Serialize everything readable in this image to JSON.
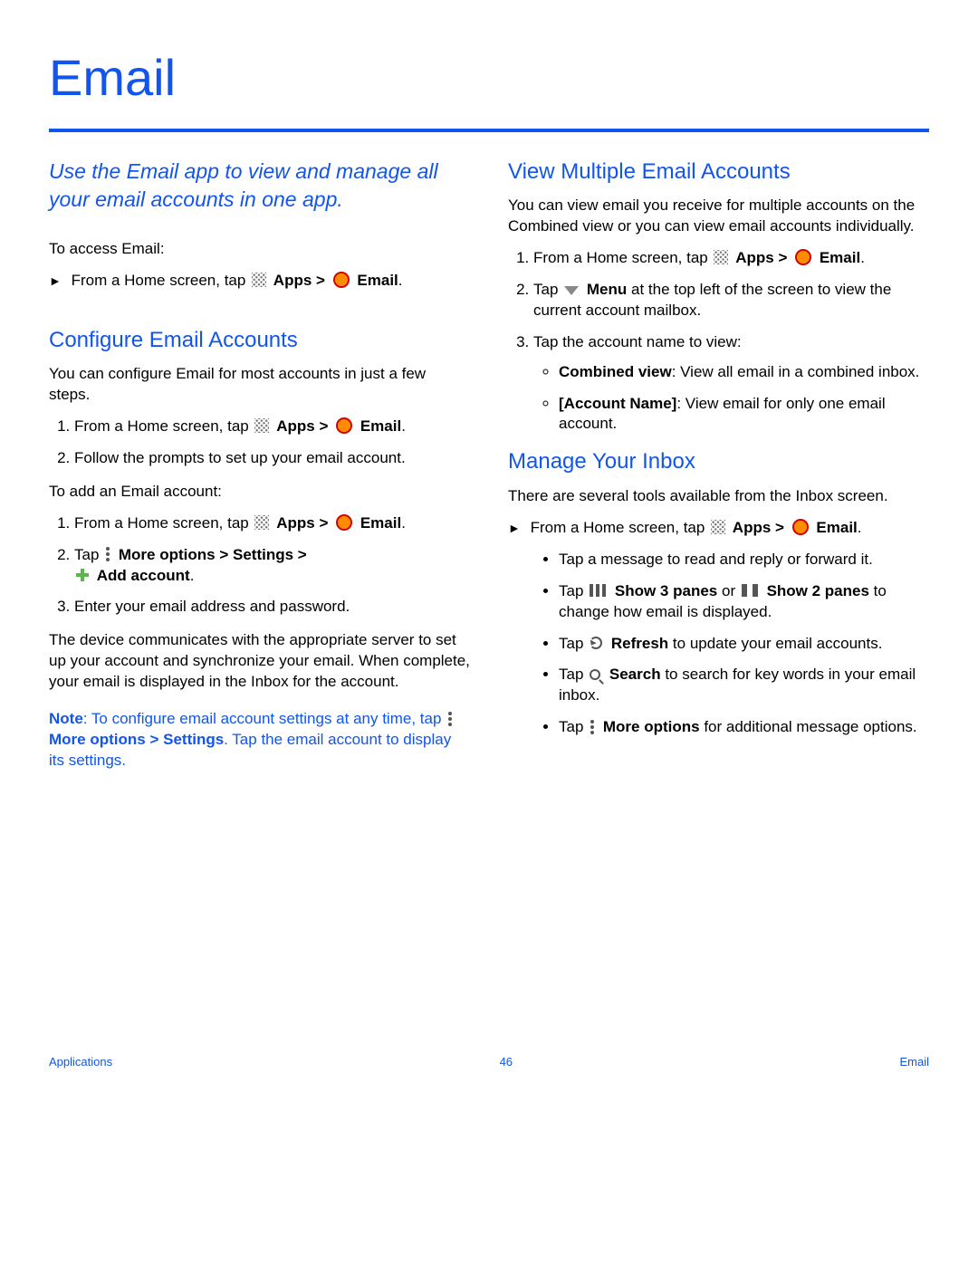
{
  "page": {
    "title": "Email",
    "intro": "Use the Email app to view and manage all your email accounts in one app."
  },
  "left": {
    "access_label": "To access Email:",
    "access_step_pre": "From a Home screen, tap ",
    "apps_label": "Apps",
    "email_label": "Email",
    "configure_heading": "Configure Email Accounts",
    "configure_intro": "You can configure Email for most accounts in just a few steps.",
    "cfg_step1_pre": "From a Home screen, tap ",
    "cfg_step2": "Follow the prompts to set up your email account.",
    "add_label": "To add an Email account:",
    "add_step1_pre": "From a Home screen, tap ",
    "add_step2_pre": "Tap ",
    "more_options": "More options",
    "settings": "Settings",
    "add_account": "Add account",
    "add_step3": "Enter your email address and password.",
    "device_para": "The device communicates with the appropriate server to set up your account and synchronize your email. When complete, your email is displayed in the Inbox for the account.",
    "note_label": "Note",
    "note_a": ": To configure email account settings at any time, tap ",
    "note_b": ". Tap the email account to display its settings."
  },
  "right": {
    "view_heading": "View Multiple Email Accounts",
    "view_intro": "You can view email you receive for multiple accounts on the Combined view or you can view email accounts individually.",
    "v_step1_pre": "From a Home screen, tap ",
    "v_step2_pre": "Tap ",
    "menu_label": "Menu",
    "v_step2_post": " at the top left of the screen to view the current account mailbox.",
    "v_step3": "Tap the account name to view:",
    "combined_label": "Combined view",
    "combined_desc": ": View all email in a combined inbox.",
    "account_label": "[Account Name]",
    "account_desc": ": View email for only one email account.",
    "manage_heading": "Manage Your Inbox",
    "manage_intro": "There are several tools available from the Inbox screen.",
    "m_step_pre": "From a Home screen, tap ",
    "m_b1": "Tap a message to read and reply or forward it.",
    "m_b2_pre": "Tap ",
    "show3": "Show 3 panes",
    "or": " or ",
    "show2": "Show 2 panes",
    "m_b2_post": " to change how email is displayed.",
    "refresh": "Refresh",
    "m_b3_post": " to update your email accounts.",
    "search": "Search",
    "m_b4_post": " to search for key words in your email inbox.",
    "m_b5_post": " for additional message options."
  },
  "footer": {
    "left": "Applications",
    "center": "46",
    "right": "Email"
  },
  "glyphs": {
    "gt": " > ",
    "period": "."
  }
}
